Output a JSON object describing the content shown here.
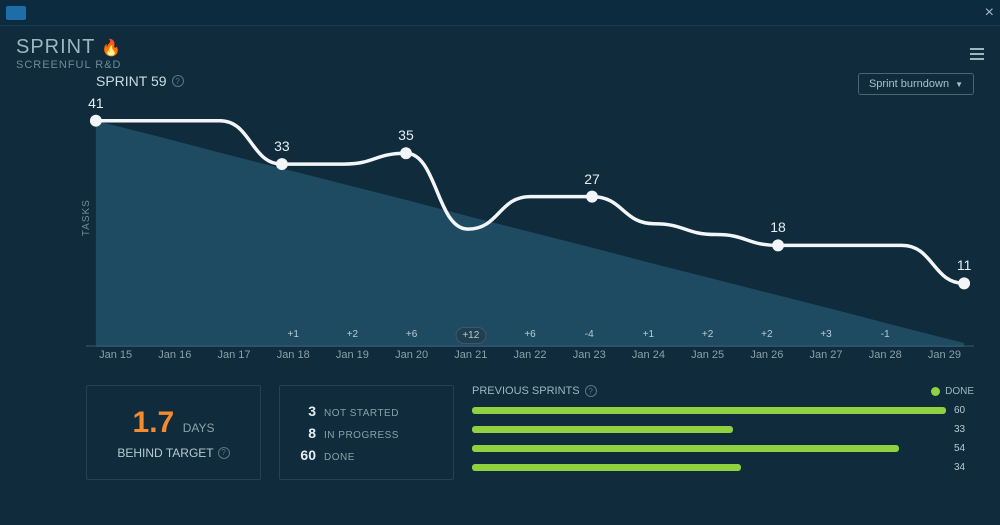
{
  "header": {
    "title": "SPRINT",
    "subtitle": "SCREENFUL R&D"
  },
  "sprint": {
    "label": "SPRINT 59",
    "dropdown": "Sprint burndown",
    "ylabel": "TASKS"
  },
  "chart_data": {
    "type": "line",
    "title": "Sprint burndown",
    "xlabel": "",
    "ylabel": "Tasks",
    "ylim": [
      0,
      45
    ],
    "categories": [
      "Jan 15",
      "Jan 16",
      "Jan 17",
      "Jan 18",
      "Jan 19",
      "Jan 20",
      "Jan 21",
      "Jan 22",
      "Jan 23",
      "Jan 24",
      "Jan 25",
      "Jan 26",
      "Jan 27",
      "Jan 28",
      "Jan 29"
    ],
    "series": [
      {
        "name": "Remaining (line)",
        "values": [
          41,
          41,
          41,
          33,
          33,
          35,
          21,
          27,
          27,
          22,
          20,
          18,
          18,
          18,
          11
        ],
        "markers": [
          {
            "i": 0,
            "v": 41,
            "label": "41"
          },
          {
            "i": 3,
            "v": 33,
            "label": "33"
          },
          {
            "i": 5,
            "v": 35,
            "label": "35"
          },
          {
            "i": 8,
            "v": 27,
            "label": "27"
          },
          {
            "i": 11,
            "v": 18,
            "label": "18"
          },
          {
            "i": 14,
            "v": 11,
            "label": "11"
          }
        ]
      },
      {
        "name": "Ideal (area)",
        "values": [
          41,
          38.1,
          35.1,
          32.2,
          29.3,
          26.4,
          23.4,
          20.5,
          17.6,
          14.6,
          11.7,
          8.8,
          5.9,
          2.9,
          0
        ]
      }
    ],
    "deltas": [
      "",
      "",
      "",
      "+1",
      "+2",
      "+6",
      "+12",
      "+6",
      "-4",
      "+1",
      "+2",
      "+2",
      "+3",
      "-1",
      ""
    ]
  },
  "kpi": {
    "value": "1.7",
    "unit": "DAYS",
    "label": "BEHIND TARGET"
  },
  "counts": [
    {
      "n": "3",
      "l": "NOT STARTED"
    },
    {
      "n": "8",
      "l": "IN PROGRESS"
    },
    {
      "n": "60",
      "l": "DONE"
    }
  ],
  "previous": {
    "title": "PREVIOUS SPRINTS",
    "legend": "DONE",
    "max": 60,
    "bars": [
      60,
      33,
      54,
      34
    ]
  }
}
